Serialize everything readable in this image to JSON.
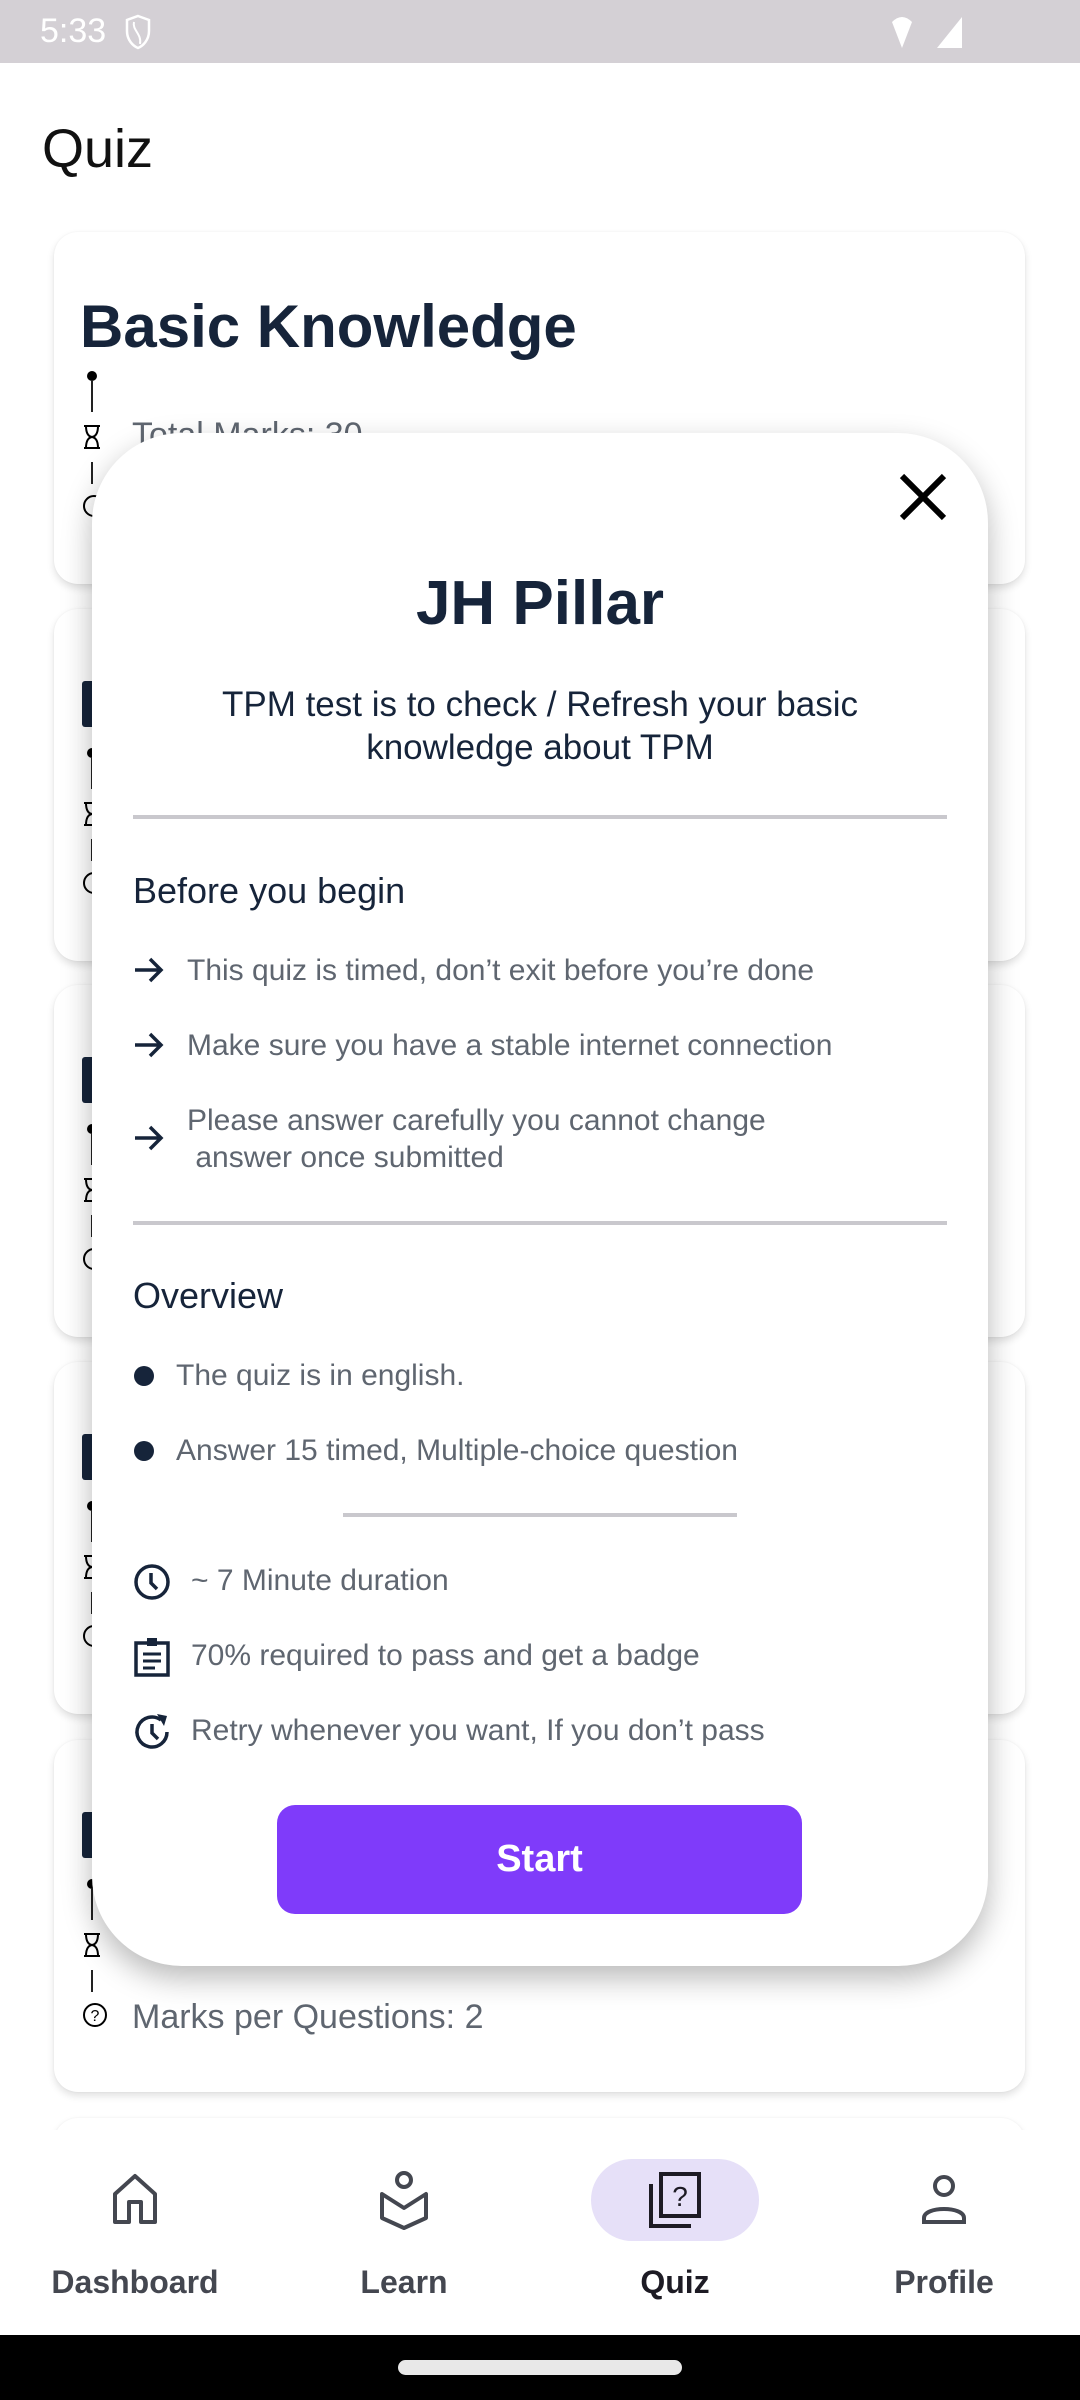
{
  "status_bar": {
    "time": "5:33"
  },
  "page": {
    "title": "Quiz"
  },
  "cards": [
    {
      "title": "Basic Knowledge",
      "total_marks": "Total Marks: 30"
    },
    {},
    {},
    {},
    {
      "marks_per_question": "Marks per Questions: 2"
    }
  ],
  "modal": {
    "title": "JH Pillar",
    "description": "TPM test is to check / Refresh your basic knowledge about TPM",
    "before_heading": "Before you begin",
    "before_items": [
      {
        "icon": "arrow-right-icon",
        "text": "This quiz is timed, don’t exit before you’re done"
      },
      {
        "icon": "arrow-right-icon",
        "text": "Make sure you have a stable internet connection"
      },
      {
        "icon": "arrow-right-icon",
        "text": "Please answer carefully you cannot change",
        "text2": " answer once submitted"
      }
    ],
    "overview_heading": "Overview",
    "overview_items": [
      "The quiz is in english.",
      "Answer 15 timed, Multiple-choice question"
    ],
    "facts": [
      {
        "icon": "clock-icon",
        "text": "~ 7 Minute duration"
      },
      {
        "icon": "clipboard-icon",
        "text": "70% required to pass and get a badge"
      },
      {
        "icon": "retry-icon",
        "text": "Retry whenever you want, If you don’t pass"
      }
    ],
    "start_label": "Start",
    "accent": "#7f3bfa"
  },
  "nav": {
    "tabs": [
      {
        "label": "Dashboard",
        "icon": "home-icon"
      },
      {
        "label": "Learn",
        "icon": "learn-icon"
      },
      {
        "label": "Quiz",
        "icon": "quiz-icon",
        "active": true
      },
      {
        "label": "Profile",
        "icon": "profile-icon"
      }
    ],
    "active_pill": "#e6e0f8"
  }
}
